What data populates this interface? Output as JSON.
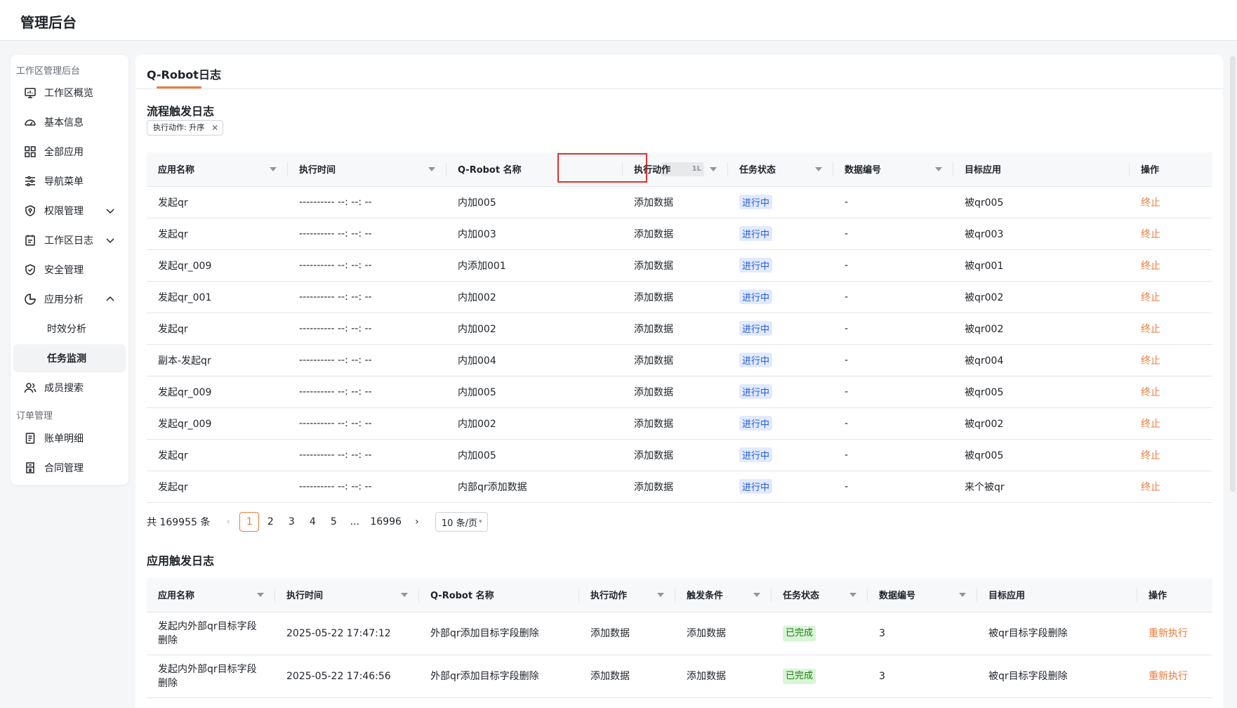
{
  "app": {
    "title": "管理后台"
  },
  "sidebar": {
    "group1": "工作区管理后台",
    "group2": "订单管理",
    "items": [
      {
        "label": "工作区概览",
        "icon": "monitor-icon"
      },
      {
        "label": "基本信息",
        "icon": "dashboard-icon"
      },
      {
        "label": "全部应用",
        "icon": "grid-icon"
      },
      {
        "label": "导航菜单",
        "icon": "sliders-icon"
      },
      {
        "label": "权限管理",
        "icon": "shield-icon"
      },
      {
        "label": "工作区日志",
        "icon": "calendar-icon"
      },
      {
        "label": "安全管理",
        "icon": "shield-check-icon"
      },
      {
        "label": "应用分析",
        "icon": "pie-chart-icon"
      },
      {
        "label": "成员搜索",
        "icon": "users-icon"
      },
      {
        "label": "账单明细",
        "icon": "receipt-icon"
      },
      {
        "label": "合同管理",
        "icon": "contract-icon"
      }
    ],
    "subitems": [
      {
        "label": "时效分析"
      },
      {
        "label": "任务监测"
      }
    ]
  },
  "tabs": [
    {
      "label": "Q-Robot日志"
    }
  ],
  "section1": {
    "title": "流程触发日志",
    "filter_tag": "执行动作: 升序",
    "columns": [
      "应用名称",
      "执行时间",
      "Q-Robot 名称",
      "执行动作",
      "任务状态",
      "数据编号",
      "目标应用",
      "操作"
    ],
    "sort_hint": "1L",
    "rows": [
      [
        "发起qr",
        "---------- --: --: --",
        "内加005",
        "添加数据",
        "进行中",
        "-",
        "被qr005",
        "终止"
      ],
      [
        "发起qr",
        "---------- --: --: --",
        "内加003",
        "添加数据",
        "进行中",
        "-",
        "被qr003",
        "终止"
      ],
      [
        "发起qr_009",
        "---------- --: --: --",
        "内添加001",
        "添加数据",
        "进行中",
        "-",
        "被qr001",
        "终止"
      ],
      [
        "发起qr_001",
        "---------- --: --: --",
        "内加002",
        "添加数据",
        "进行中",
        "-",
        "被qr002",
        "终止"
      ],
      [
        "发起qr",
        "---------- --: --: --",
        "内加002",
        "添加数据",
        "进行中",
        "-",
        "被qr002",
        "终止"
      ],
      [
        "副本-发起qr",
        "---------- --: --: --",
        "内加004",
        "添加数据",
        "进行中",
        "-",
        "被qr004",
        "终止"
      ],
      [
        "发起qr_009",
        "---------- --: --: --",
        "内加005",
        "添加数据",
        "进行中",
        "-",
        "被qr005",
        "终止"
      ],
      [
        "发起qr_009",
        "---------- --: --: --",
        "内加002",
        "添加数据",
        "进行中",
        "-",
        "被qr002",
        "终止"
      ],
      [
        "发起qr",
        "---------- --: --: --",
        "内加005",
        "添加数据",
        "进行中",
        "-",
        "被qr005",
        "终止"
      ],
      [
        "发起qr",
        "---------- --: --: --",
        "内部qr添加数据",
        "添加数据",
        "进行中",
        "-",
        "来个被qr",
        "终止"
      ]
    ],
    "pagination": {
      "total": "共 169955 条",
      "prev": "‹",
      "pages": [
        "1",
        "2",
        "3",
        "4",
        "5",
        "...",
        "16996"
      ],
      "next": "›",
      "page_size": "10 条/页"
    }
  },
  "section2": {
    "title": "应用触发日志",
    "columns": [
      "应用名称",
      "执行时间",
      "Q-Robot 名称",
      "执行动作",
      "触发条件",
      "任务状态",
      "数据编号",
      "目标应用",
      "操作"
    ],
    "rows": [
      [
        "发起内外部qr目标字段删除",
        "2025-05-22 17:47:12",
        "外部qr添加目标字段删除",
        "添加数据",
        "添加数据",
        "已完成",
        "3",
        "被qr目标字段删除",
        "重新执行"
      ],
      [
        "发起内外部qr目标字段删除",
        "2025-05-22 17:46:56",
        "外部qr添加目标字段删除",
        "添加数据",
        "添加数据",
        "已完成",
        "3",
        "被qr目标字段删除",
        "重新执行"
      ]
    ]
  }
}
